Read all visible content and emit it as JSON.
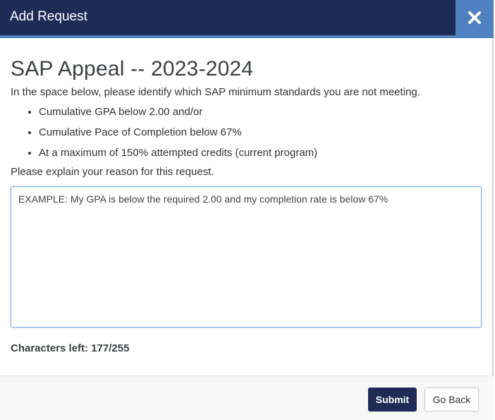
{
  "dialog": {
    "title": "Add Request",
    "close_icon": "close-icon"
  },
  "body": {
    "heading": "SAP Appeal -- 2023-2024",
    "intro": "In the space below, please identify which SAP minimum standards you are not meeting.",
    "standards": [
      "Cumulative GPA below 2.00 and/or",
      "Cumulative Pace of Completion below 67%",
      "At a maximum of 150% attempted credits (current program)"
    ],
    "explain_label": "Please explain your reason for this request.",
    "reason_value": "EXAMPLE: My GPA is below the required 2.00 and my completion rate is below 67%",
    "chars_left": "Characters left: 177/255"
  },
  "footer": {
    "submit_label": "Submit",
    "back_label": "Go Back"
  },
  "colors": {
    "header_bg": "#1e2b57",
    "accent": "#4f80bf",
    "submit_bg": "#1e2b57"
  }
}
